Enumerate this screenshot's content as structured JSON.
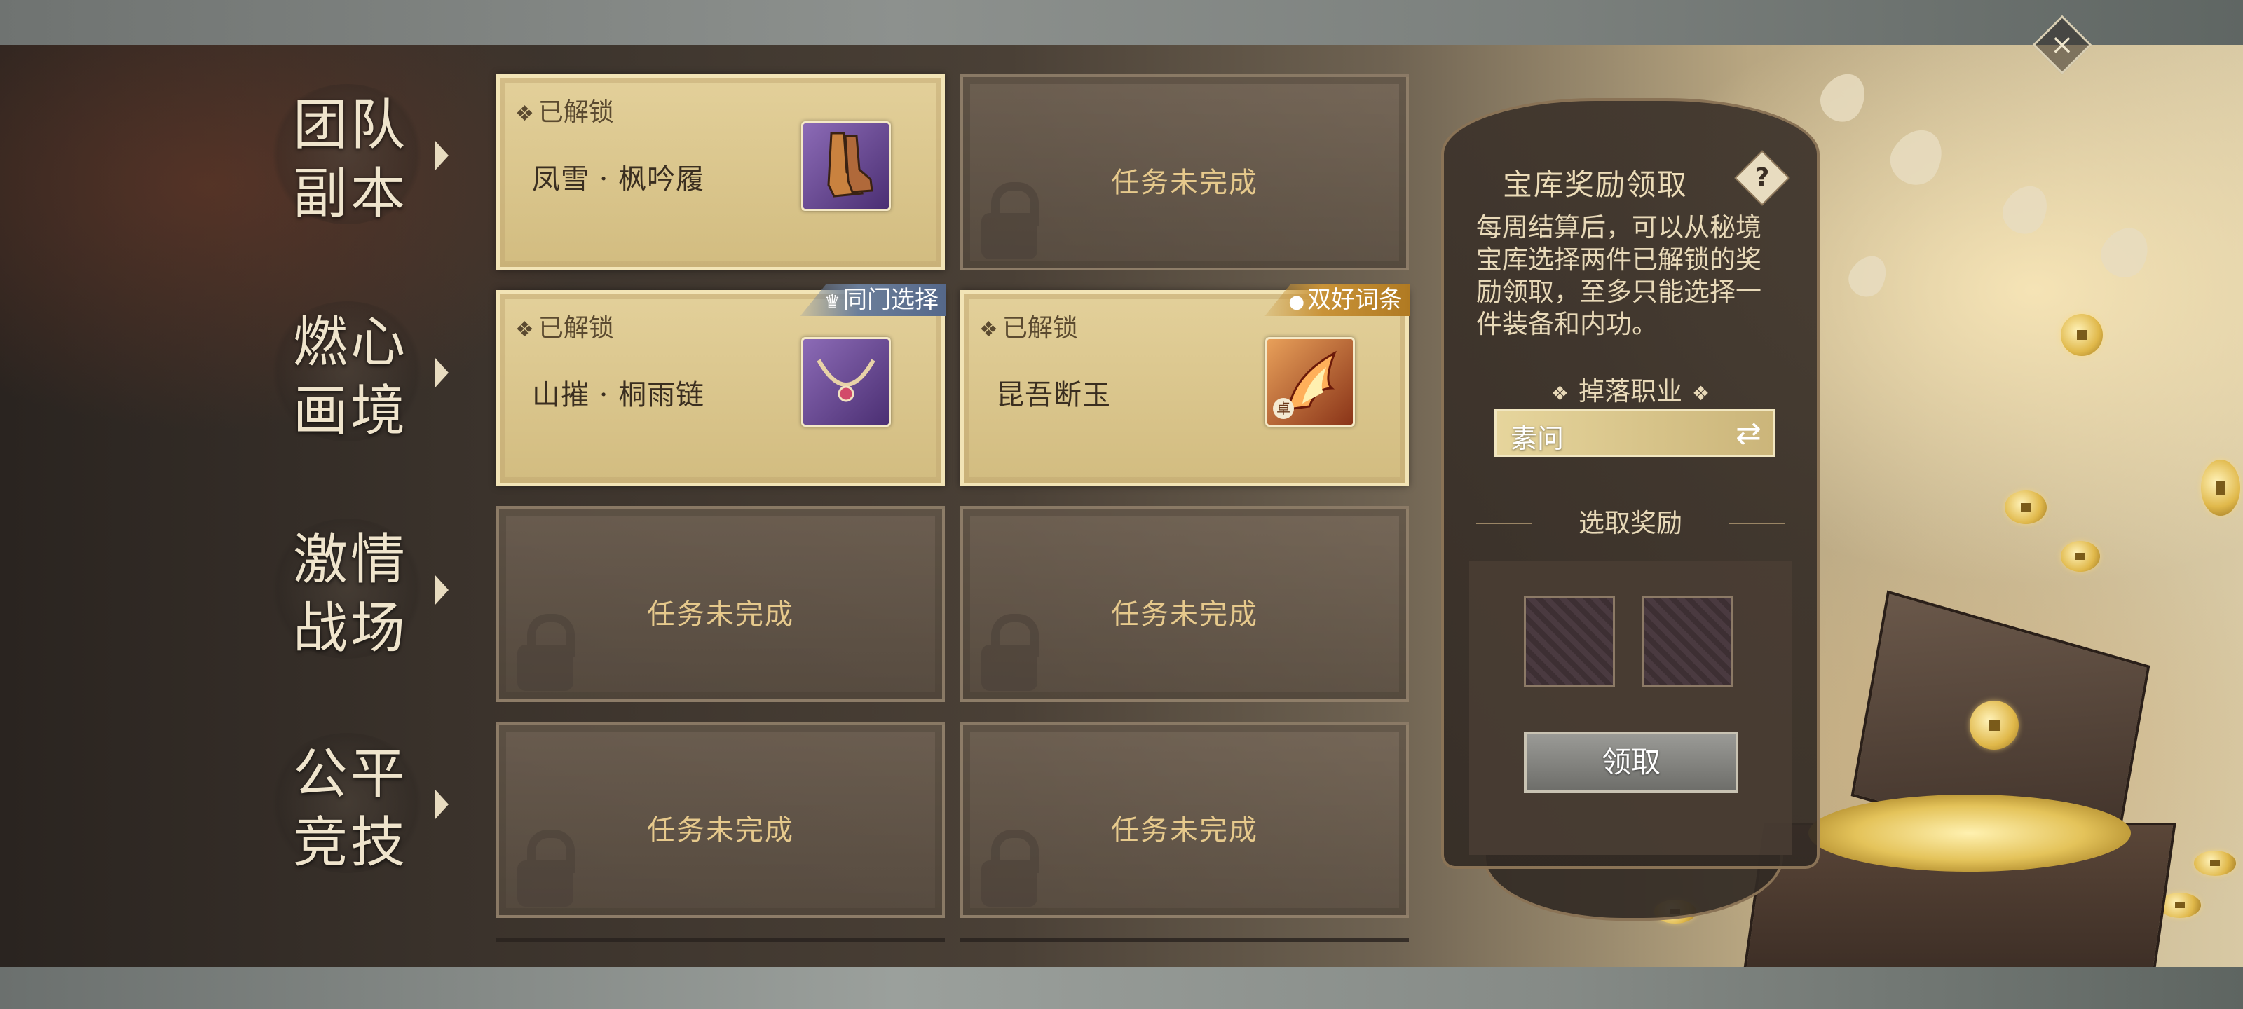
{
  "categories": [
    {
      "label": "团队\n副本"
    },
    {
      "label": "燃心\n画境"
    },
    {
      "label": "激情\n战场"
    },
    {
      "label": "公平\n竞技"
    }
  ],
  "slots": {
    "raid_1": {
      "status": "已解锁",
      "item_name": "凤雪 · 枫吟履",
      "icon": "boots-icon"
    },
    "raid_2": {
      "text": "任务未完成"
    },
    "heart_1": {
      "status": "已解锁",
      "item_name": "山摧 · 桐雨链",
      "icon": "necklace-icon",
      "tag": "同门选择"
    },
    "heart_2": {
      "status": "已解锁",
      "item_name": "昆吾断玉",
      "icon": "flame-skill-icon",
      "tag": "双好词条",
      "badge": "卓"
    },
    "battle_1": {
      "text": "任务未完成"
    },
    "battle_2": {
      "text": "任务未完成"
    },
    "arena_1": {
      "text": "任务未完成"
    },
    "arena_2": {
      "text": "任务未完成"
    }
  },
  "panel": {
    "title": "宝库奖励领取",
    "help": "?",
    "description": "每周结算后，可以从秘境宝库选择两件已解锁的奖励领取，至多只能选择一件装备和内功。",
    "drop_class_label": "掉落职业",
    "class_value": "素问",
    "select_reward_label": "选取奖励",
    "claim_label": "领取"
  },
  "colors": {
    "unlocked_card": "#d9c48a",
    "locked_card": "#6e5f50",
    "locked_text": "#e6c98c",
    "tag_blue": "#6b7e9a",
    "tag_gold": "#c99338"
  }
}
